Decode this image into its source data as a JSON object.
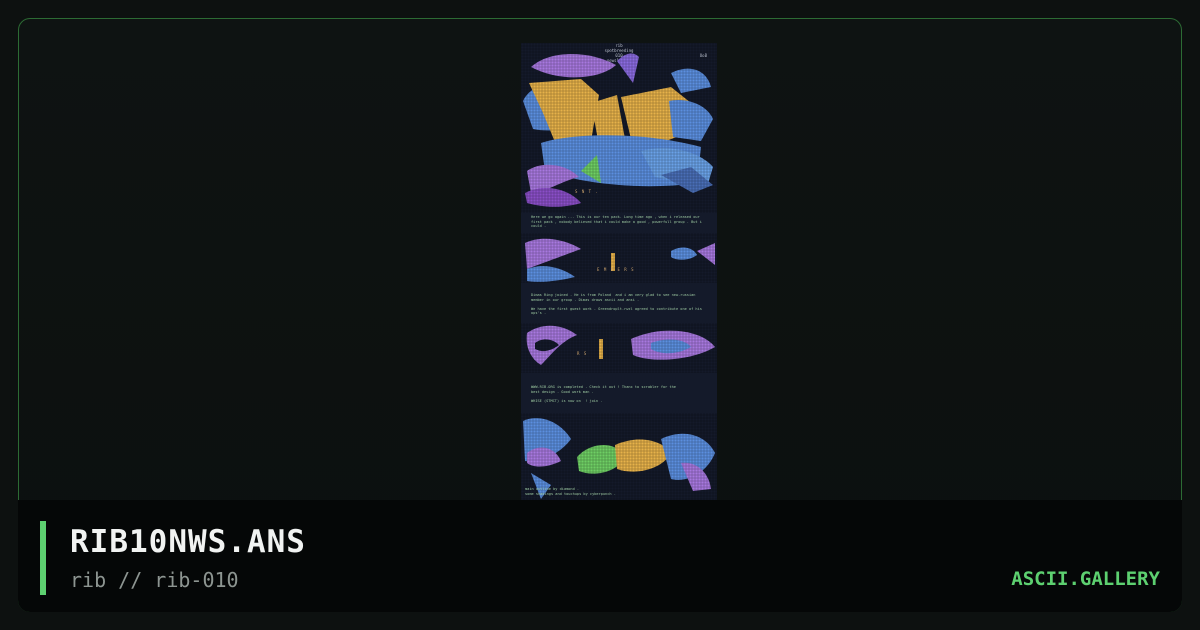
{
  "artwork": {
    "header_lines": [
      "rib",
      "spotbreeding",
      "010",
      "newsletter"
    ],
    "header_side": "Oo8",
    "headings": [
      "S    N T .",
      "    E M B E R S",
      "R        S"
    ],
    "paragraphs": [
      "Here we go again ... This is our ten pack. Long time ago , when i released our first pack , nobody believed that i could make a good , powerfull group . But i could .",
      "Dimas Ring joined . He is from Poland  and i am very glad to see new-russian member in our group . Dimas draws ascii and ansi .\n\nWe have the first guest work - Greendroplt-rwzl agreed to contribute one of his ops's .",
      "WWW.RIB.ORG is completed . Check it out ! Thanx to scrabler for the             best design . Good work man .\n\nWHISE (STMCT) is now on  ! join .",
      "main outline by diamond .\nsome shadings and touchups by cyberpunch ."
    ]
  },
  "caption": {
    "title": "RIB10NWS.ANS",
    "subtitle": "rib // rib-010",
    "brand": "ASCII.GALLERY"
  },
  "colors": {
    "accent": "#5dd070",
    "border": "#2c6b34",
    "purple": "#a878e0",
    "blue": "#5b8fe0",
    "yellow": "#e7b24a",
    "green": "#6fcf64"
  }
}
